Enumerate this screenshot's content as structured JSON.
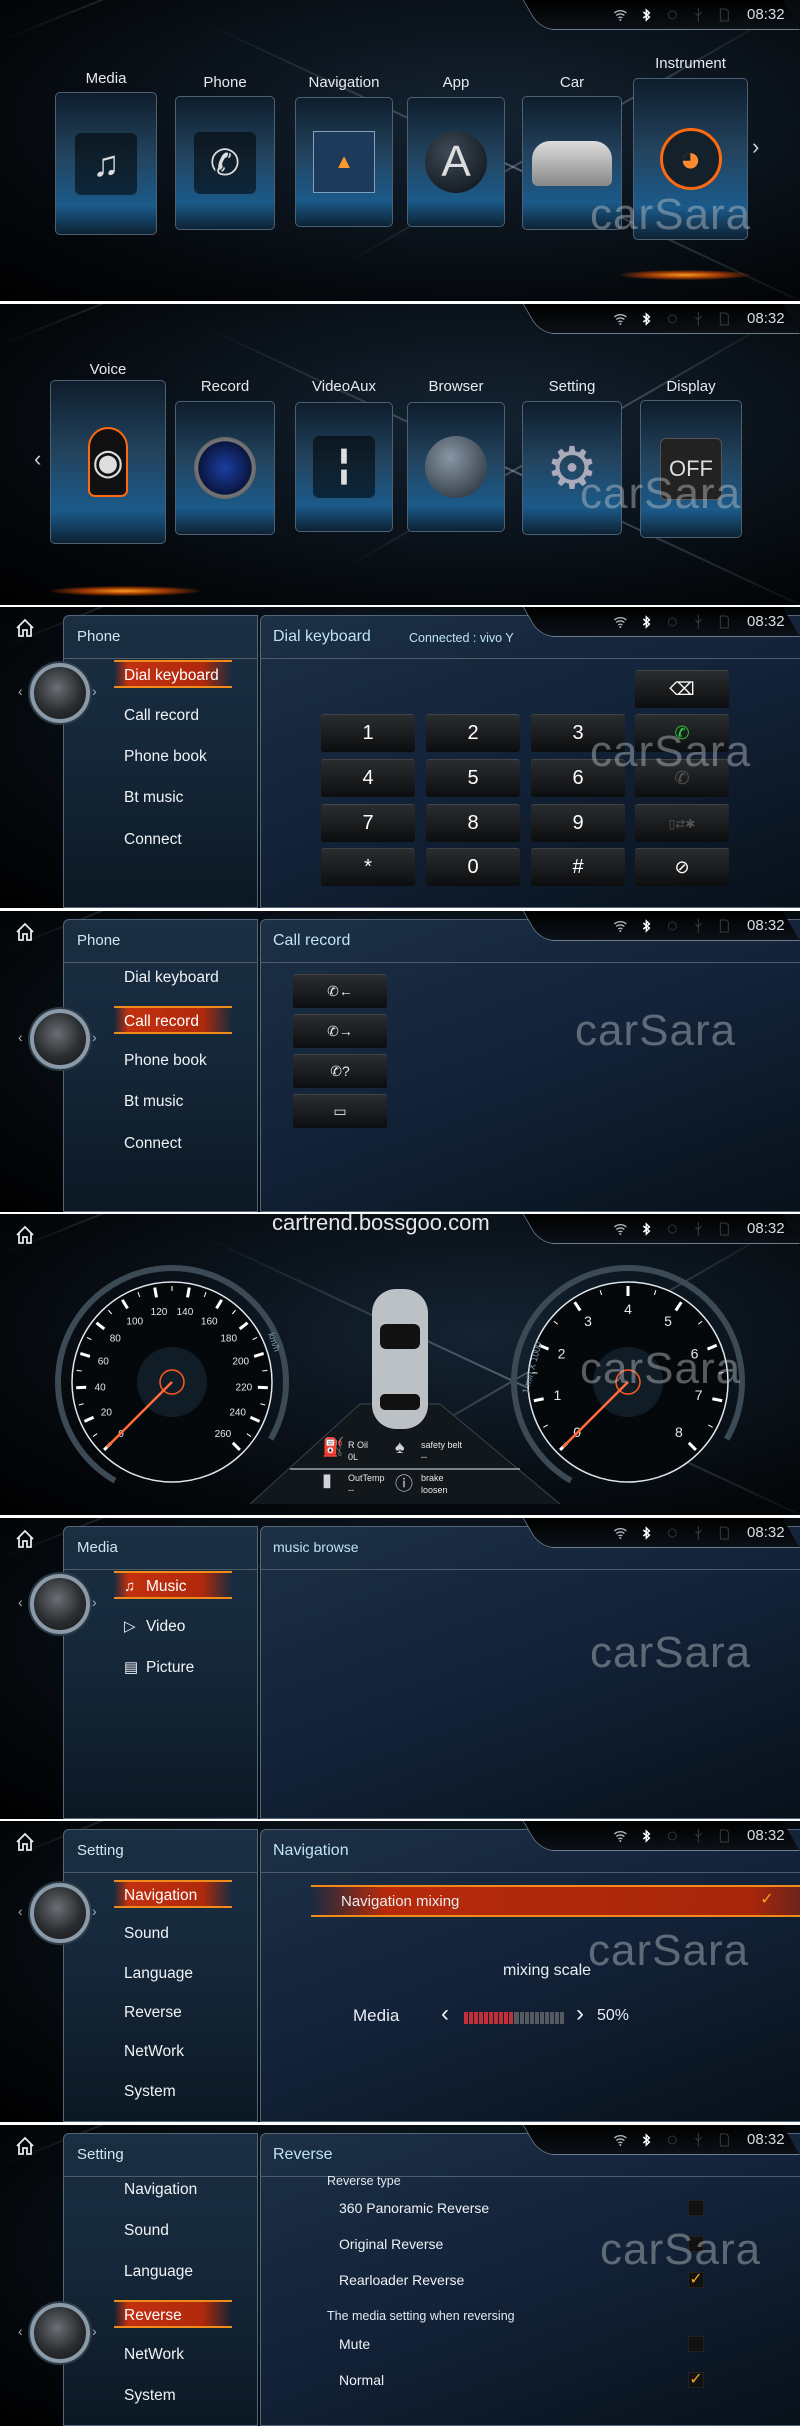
{
  "status_bar": {
    "time": "08:32",
    "icons": [
      "wifi-icon",
      "bluetooth-icon",
      "gps-icon",
      "usb-icon",
      "sd-card-icon"
    ]
  },
  "watermark": "carSara",
  "colors": {
    "accent": "#c2300f",
    "accent_line": "#f08a1a",
    "title_text": "#bfe3f4",
    "check": "#f5a623",
    "call_green": "#2ecc40"
  },
  "home1": {
    "apps": [
      {
        "label": "Media",
        "icon": "music-note-icon"
      },
      {
        "label": "Phone",
        "icon": "phone-chat-icon"
      },
      {
        "label": "Navigation",
        "icon": "map-icon"
      },
      {
        "label": "App",
        "icon": "app-globe-icon"
      },
      {
        "label": "Car",
        "icon": "car-icon"
      },
      {
        "label": "Instrument",
        "icon": "speedometer-icon"
      }
    ],
    "next_icon": "chevron-right-icon"
  },
  "home2": {
    "apps": [
      {
        "label": "Voice",
        "icon": "microphone-icon"
      },
      {
        "label": "Record",
        "icon": "camera-lens-icon"
      },
      {
        "label": "VideoAux",
        "icon": "aux-jack-icon"
      },
      {
        "label": "Browser",
        "icon": "planet-icon"
      },
      {
        "label": "Setting",
        "icon": "gear-icon"
      },
      {
        "label": "Display",
        "icon": "display-off-icon",
        "text": "OFF"
      }
    ],
    "prev_icon": "chevron-left-icon"
  },
  "phone_menu": {
    "title": "Phone",
    "items": [
      "Dial keyboard",
      "Call record",
      "Phone book",
      "Bt music",
      "Connect"
    ]
  },
  "dial": {
    "title": "Dial keyboard",
    "connected": "Connected : vivo Y",
    "keys": [
      "1",
      "2",
      "3",
      "4",
      "5",
      "6",
      "7",
      "8",
      "9",
      "*",
      "0",
      "#"
    ],
    "side_keys": [
      "backspace-icon",
      "call-icon",
      "hangup-icon",
      "bt-transfer-icon",
      "disconnect-icon"
    ],
    "selected": 0
  },
  "call_record": {
    "title": "Call record",
    "buttons": [
      "incoming-call-icon",
      "outgoing-call-icon",
      "missed-call-icon",
      "trash-icon"
    ],
    "selected": 1
  },
  "dashboard": {
    "site_text": "cartrend.bossgoo.com",
    "speed_labels": [
      "0",
      "20",
      "40",
      "60",
      "80",
      "100",
      "120",
      "140",
      "160",
      "180",
      "200",
      "220",
      "240",
      "260"
    ],
    "speed_unit": "km/h",
    "rpm_labels": [
      "0",
      "1",
      "2",
      "3",
      "4",
      "5",
      "6",
      "7",
      "8"
    ],
    "rpm_unit": "1 min X 1000",
    "speed_value": 0,
    "rpm_value": 0,
    "indicators": [
      {
        "icon": "fuel-icon",
        "label": "R Oil",
        "value": "0L"
      },
      {
        "icon": "seatbelt-icon",
        "label": "safety belt",
        "value": "--"
      },
      {
        "icon": "thermometer-icon",
        "label": "OutTemp",
        "value": "--"
      },
      {
        "icon": "brake-icon",
        "label": "brake",
        "value": "loosen"
      }
    ]
  },
  "media_menu": {
    "title": "Media",
    "items": [
      {
        "label": "Music",
        "icon": "music-note-icon"
      },
      {
        "label": "Video",
        "icon": "play-circle-icon"
      },
      {
        "label": "Picture",
        "icon": "picture-icon"
      }
    ],
    "selected": 0,
    "content_title": "music browse"
  },
  "setting_menu": {
    "title": "Setting",
    "items": [
      "Navigation",
      "Sound",
      "Language",
      "Reverse",
      "NetWork",
      "System"
    ]
  },
  "nav_setting": {
    "title": "Navigation",
    "selected_menu": 0,
    "mixing_label": "Navigation mixing",
    "mixing_checked": true,
    "scale_label": "mixing scale",
    "media_label": "Media",
    "media_percent": 50,
    "media_value_text": "50%"
  },
  "reverse_setting": {
    "title": "Reverse",
    "selected_menu": 3,
    "type_heading": "Reverse type",
    "types": [
      {
        "label": "360 Panoramic Reverse",
        "checked": false
      },
      {
        "label": "Original Reverse",
        "checked": false
      },
      {
        "label": "Rearloader Reverse",
        "checked": true
      }
    ],
    "media_heading": "The media setting when reversing",
    "media_options": [
      {
        "label": "Mute",
        "checked": false
      },
      {
        "label": "Normal",
        "checked": true
      }
    ]
  }
}
